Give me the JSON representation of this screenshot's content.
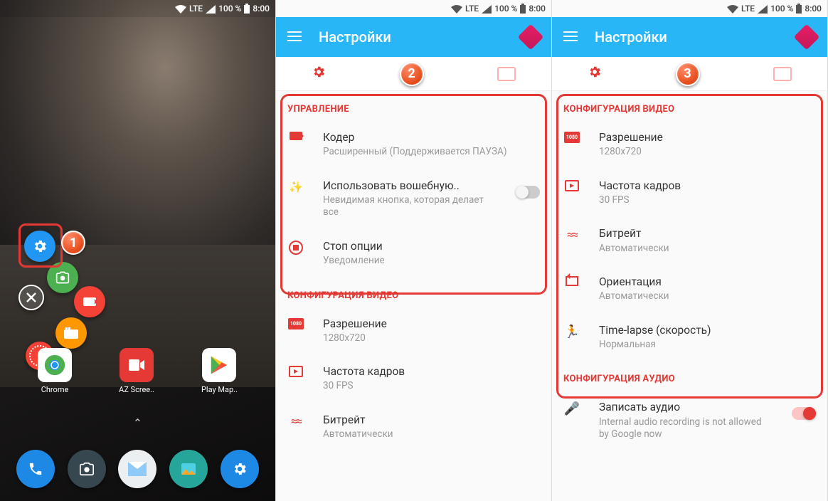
{
  "status": {
    "network": "LTE",
    "battery": "100 %",
    "time": "8:00"
  },
  "appbar": {
    "title": "Настройки"
  },
  "home": {
    "apps": {
      "chrome": "Chrome",
      "az": "AZ Scree..",
      "play": "Play Мар.."
    }
  },
  "badges": {
    "b1": "1",
    "b2": "2",
    "b3": "3"
  },
  "panel2": {
    "section1": "УПРАВЛЕНИЕ",
    "coder": {
      "title": "Кодер",
      "sub": "Расширенный (Поддерживается ПАУЗА)"
    },
    "magic": {
      "title": "Использовать вошебную..",
      "sub": "Невидимая кнопка, которая делает все"
    },
    "stop": {
      "title": "Стоп опции",
      "sub": "Уведомление"
    },
    "section2": "КОНФИГУРАЦИЯ ВИДЕО",
    "res": {
      "title": "Разрешение",
      "sub": "1280x720"
    },
    "fps": {
      "title": "Частота кадров",
      "sub": "30 FPS"
    },
    "bitrate": {
      "title": "Битрейт",
      "sub": "Автоматически"
    }
  },
  "panel3": {
    "section1": "КОНФИГУРАЦИЯ ВИДЕО",
    "res": {
      "title": "Разрешение",
      "sub": "1280x720"
    },
    "fps": {
      "title": "Частота кадров",
      "sub": "30 FPS"
    },
    "bitrate": {
      "title": "Битрейт",
      "sub": "Автоматически"
    },
    "orient": {
      "title": "Ориентация",
      "sub": "Автоматически"
    },
    "timelapse": {
      "title": "Time-lapse (скорость)",
      "sub": "Нормальная"
    },
    "section2": "КОНФИГУРАЦИЯ АУДИО",
    "audio": {
      "title": "Записать аудио",
      "sub": "Internal audio recording is not allowed by Google now"
    }
  }
}
